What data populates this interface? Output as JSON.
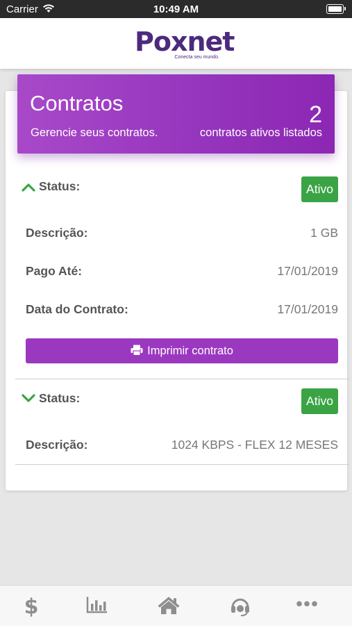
{
  "status_bar": {
    "carrier": "Carrier",
    "time": "10:49 AM"
  },
  "header": {
    "logo_text": "Poxnet",
    "logo_tagline": "Conecta seu mundo."
  },
  "banner": {
    "title": "Contratos",
    "subtitle": "Gerencie seus contratos.",
    "count": "2",
    "count_label": "contratos ativos listados"
  },
  "contracts": [
    {
      "expanded": true,
      "status_label": "Status:",
      "status_value": "Ativo",
      "descricao_label": "Descrição:",
      "descricao_value": "1 GB",
      "pago_label": "Pago Até:",
      "pago_value": "17/01/2019",
      "data_label": "Data do Contrato:",
      "data_value": "17/01/2019",
      "print_label": "Imprimir contrato"
    },
    {
      "expanded": false,
      "status_label": "Status:",
      "status_value": "Ativo",
      "descricao_label": "Descrição:",
      "descricao_value": "1024 KBPS - FLEX 12 MESES"
    }
  ],
  "tabbar": {
    "items": [
      {
        "icon": "dollar-icon"
      },
      {
        "icon": "bar-chart-icon"
      },
      {
        "icon": "home-icon"
      },
      {
        "icon": "headset-icon"
      },
      {
        "icon": "more-icon"
      }
    ]
  },
  "colors": {
    "brand_purple": "#9b38c0",
    "logo_purple": "#4c2a7e",
    "status_green": "#3aa445",
    "chevron_green": "#3aa445",
    "tab_icon_gray": "#8e8e8e"
  }
}
